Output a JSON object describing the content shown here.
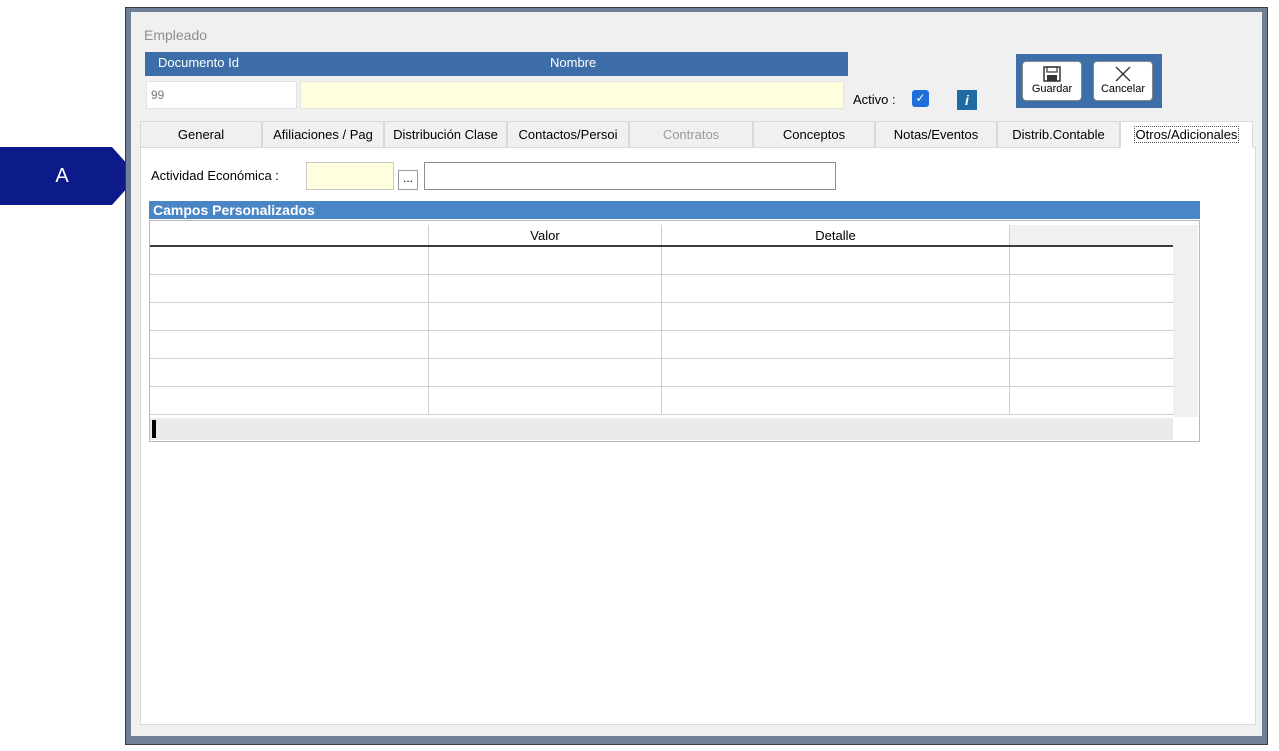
{
  "callout": {
    "label": "A",
    "color": "#0d1a8a"
  },
  "window": {
    "title": "Empleado"
  },
  "header": {
    "doc_label": "Documento Id",
    "name_label": "Nombre",
    "doc_value": "99",
    "name_value": "",
    "activo_label": "Activo :",
    "activo_checked": true
  },
  "toolbar": {
    "save_label": "Guardar",
    "cancel_label": "Cancelar"
  },
  "tabs": [
    {
      "label": "General"
    },
    {
      "label": "Afiliaciones / Pag"
    },
    {
      "label": "Distribución Clase"
    },
    {
      "label": "Contactos/Persoi"
    },
    {
      "label": "Contratos",
      "disabled": true
    },
    {
      "label": "Conceptos"
    },
    {
      "label": "Notas/Eventos"
    },
    {
      "label": "Distrib.Contable"
    },
    {
      "label": "Otros/Adicionales",
      "active": true
    }
  ],
  "actividad": {
    "label": "Actividad Económica :",
    "code": "",
    "dots": "...",
    "description": ""
  },
  "grid": {
    "title": "Campos Personalizados",
    "columns": [
      "",
      "Valor",
      "Detalle",
      ""
    ],
    "rows": [
      [
        "",
        "",
        "",
        ""
      ],
      [
        "",
        "",
        "",
        ""
      ],
      [
        "",
        "",
        "",
        ""
      ],
      [
        "",
        "",
        "",
        ""
      ],
      [
        "",
        "",
        "",
        ""
      ],
      [
        "",
        "",
        "",
        ""
      ]
    ]
  }
}
